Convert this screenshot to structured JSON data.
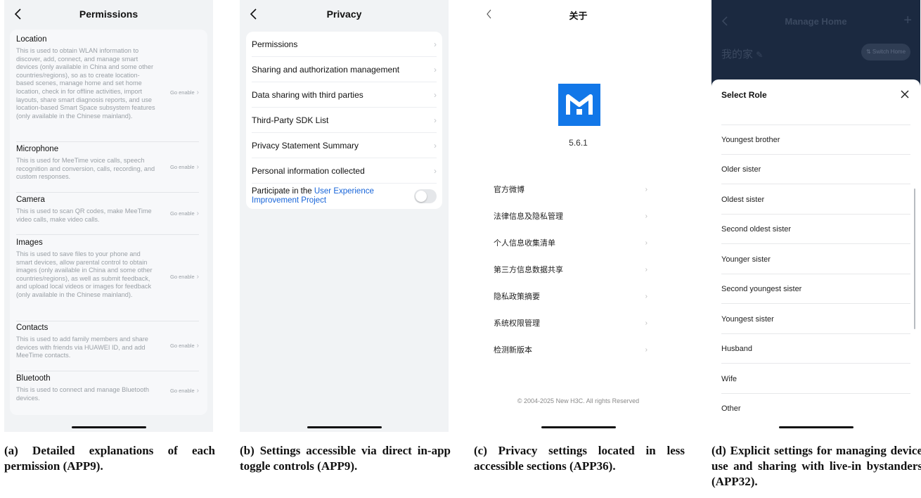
{
  "screen1": {
    "title": "Permissions",
    "action_label": "Go enable",
    "permissions": [
      {
        "title": "Location",
        "desc": "This is used to obtain WLAN information to discover, add, connect, and manage smart devices (only available in China and some other countries/regions), so as to create location-based scenes, manage home and set home location, check in for offline activities, import layouts, share smart diagnosis reports, and use location-based Smart Space subsystem features (only available in the Chinese mainland)."
      },
      {
        "title": "Microphone",
        "desc": "This is used for MeeTime voice calls, speech recognition and conversion, calls, recording, and custom responses."
      },
      {
        "title": "Camera",
        "desc": "This is used to scan QR codes, make MeeTime video calls, make video calls."
      },
      {
        "title": "Images",
        "desc": "This is used to save files to your phone and smart devices, allow parental control to obtain images (only available in China and some other countries/regions), as well as submit feedback, and upload local videos or images for feedback (only available in the Chinese mainland)."
      },
      {
        "title": "Contacts",
        "desc": "This is used to add family members and share devices with friends via HUAWEI ID, and add MeeTime contacts."
      },
      {
        "title": "Bluetooth",
        "desc": "This is used to connect and manage Bluetooth devices."
      }
    ]
  },
  "screen2": {
    "title": "Privacy",
    "items": [
      "Permissions",
      "Sharing and authorization management",
      "Data sharing with third parties",
      "Third-Party SDK List",
      "Privacy Statement Summary",
      "Personal information collected"
    ],
    "ux_prefix": "Participate in the ",
    "ux_link": "User Experience Improvement Project",
    "ux_toggle_on": false
  },
  "screen3": {
    "title": "关于",
    "version": "5.6.1",
    "items": [
      "官方微博",
      "法律信息及隐私管理",
      "个人信息收集清单",
      "第三方信息数据共享",
      "隐私政策摘要",
      "系统权限管理",
      "检测新版本"
    ],
    "copyright": "© 2004-2025 New H3C. All rights Reserved",
    "brand_color": "#1277e8"
  },
  "screen4": {
    "header_title": "Manage Home",
    "home_name": "我的家",
    "switch_label": "⇅ Switch Home",
    "sheet_title": "Select Role",
    "roles": [
      "Youngest brother",
      "Older sister",
      "Oldest sister",
      "Second oldest sister",
      "Younger sister",
      "Second youngest sister",
      "Youngest sister",
      "Husband",
      "Wife",
      "Other"
    ]
  },
  "captions": {
    "a": "(a) Detailed explanations of each permission (APP9).",
    "b": "(b) Settings accessible via direct in-app toggle controls (APP9).",
    "c": "(c) Privacy settings located in less accessible sections (APP36).",
    "d": "(d) Explicit settings for managing device use and sharing with live-in bystanders (APP32)."
  }
}
